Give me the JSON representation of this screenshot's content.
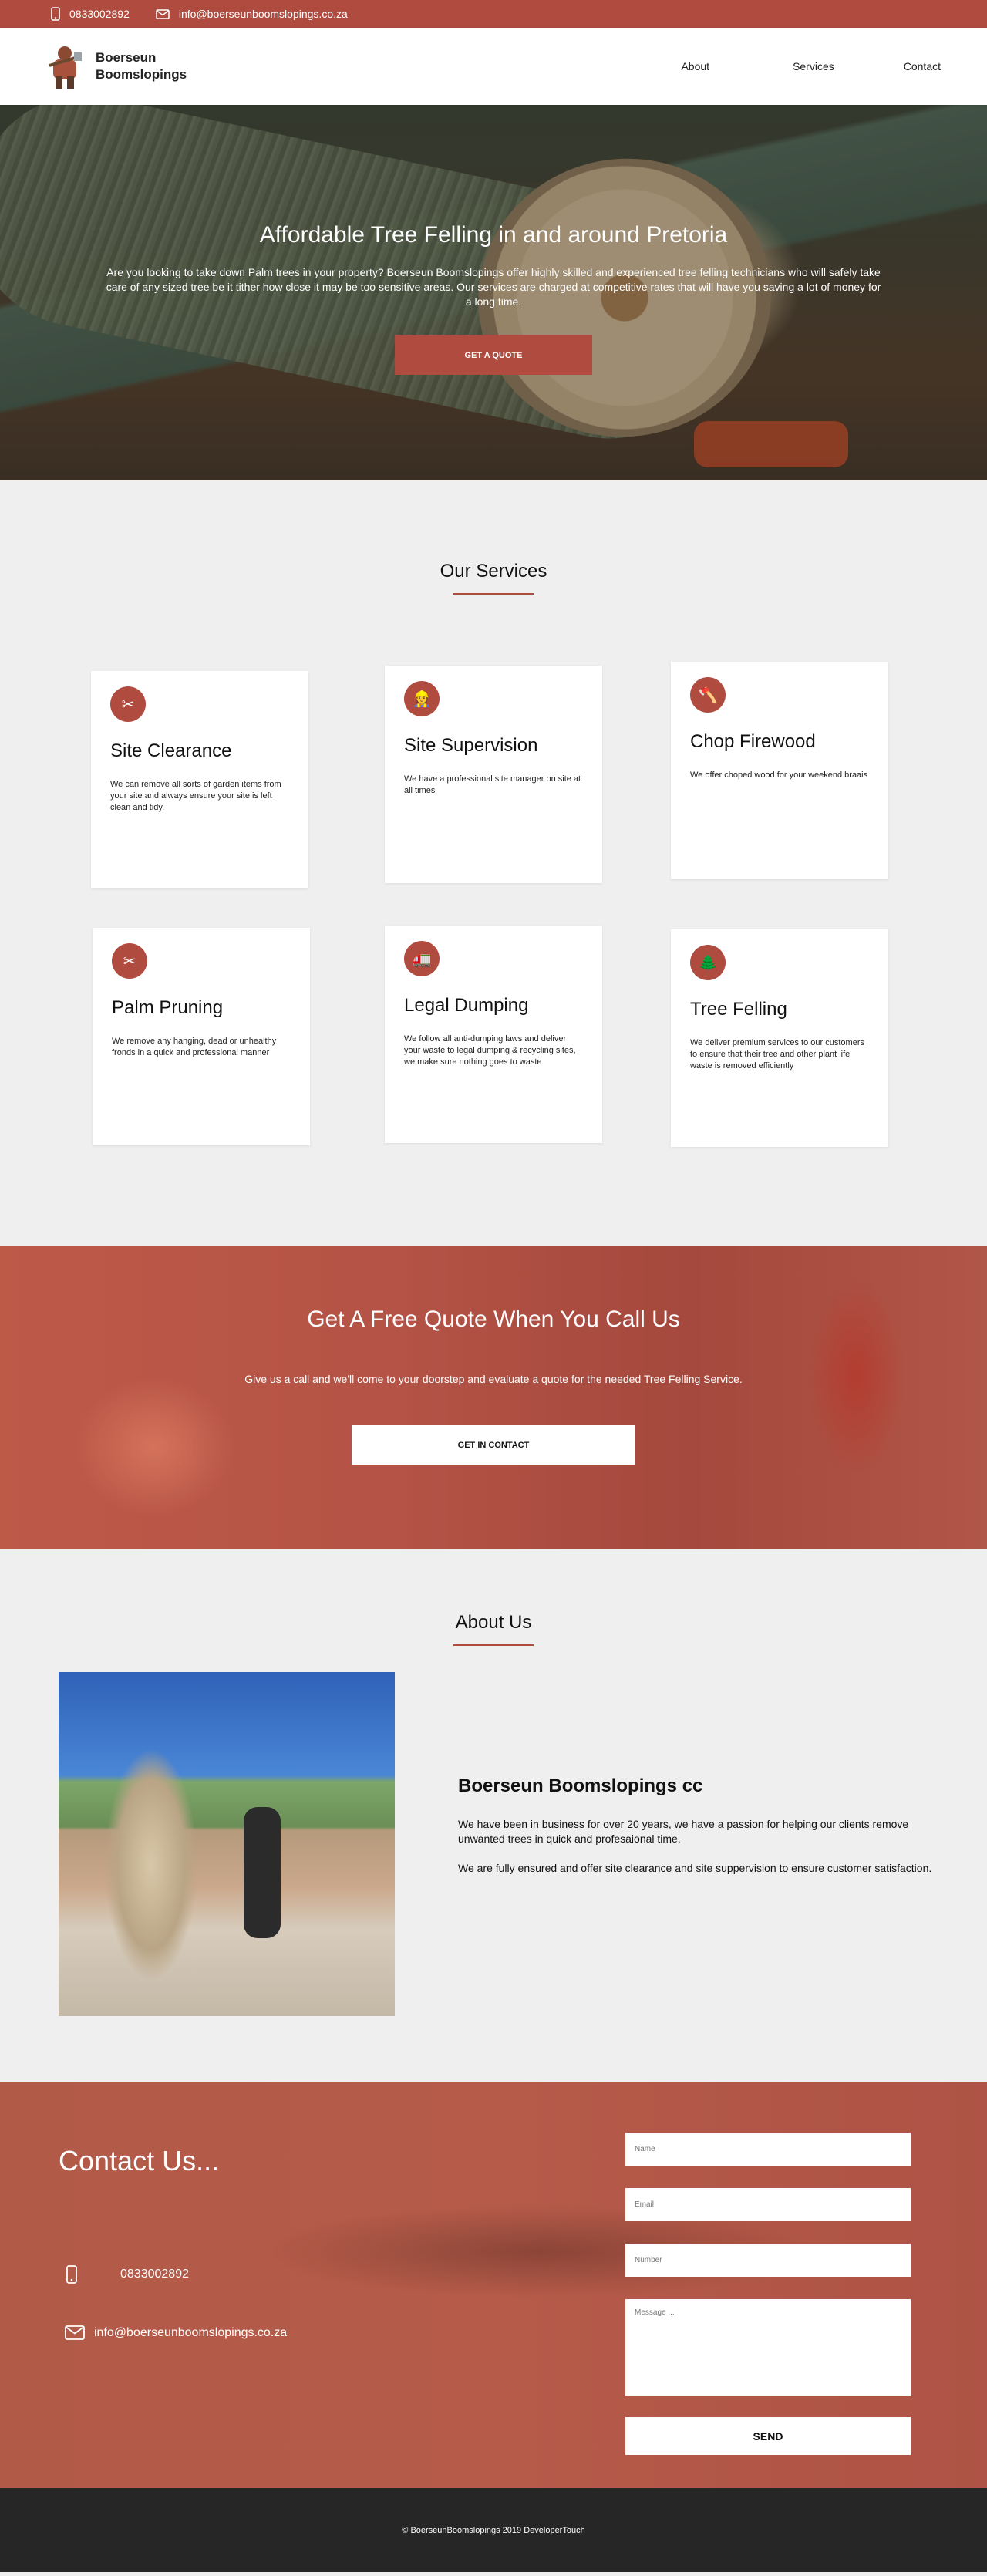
{
  "topbar": {
    "phone": "0833002892",
    "email": "info@boerseunboomslopings.co.za",
    "phone_icon": "phone-icon",
    "email_icon": "mail-icon"
  },
  "header": {
    "brand_line1": "Boerseun",
    "brand_line2": "Boomslopings",
    "nav": [
      "About",
      "Services",
      "Contact"
    ]
  },
  "hero": {
    "title": "Affordable Tree Felling in and around Pretoria",
    "text": "Are you looking to take down Palm trees in your property? Boerseun Boomslopings offer highly skilled and experienced tree felling technicians who will safely take care of any sized tree be it tither how close it may be too sensitive areas. Our services are charged at competitive rates that will have you saving a lot of money for a long time.",
    "button": "GET A QUOTE"
  },
  "services": {
    "title": "Our Services",
    "cards": [
      {
        "title": "Site Clearance",
        "text": "We can remove all sorts of garden items from your site and always ensure your site is left clean and tidy.",
        "icon": "clearance-icon"
      },
      {
        "title": "Site Supervision",
        "text": "We have a professional site manager on site at all times",
        "icon": "supervision-icon"
      },
      {
        "title": "Chop Firewood",
        "text": "We offer choped wood for your weekend braais",
        "icon": "firewood-icon"
      },
      {
        "title": "Palm Pruning",
        "text": "We remove any hanging, dead or unhealthy fronds in a quick and professional manner",
        "icon": "pruning-icon"
      },
      {
        "title": "Legal Dumping",
        "text": "We follow all anti-dumping laws and deliver your waste to legal dumping & recycling sites, we make sure nothing goes to waste",
        "icon": "dumping-icon"
      },
      {
        "title": "Tree Felling",
        "text": "We deliver premium services to our customers to ensure that their tree and other plant life waste is removed efficiently",
        "icon": "felling-icon"
      }
    ]
  },
  "cta": {
    "title": "Get A Free Quote When You Call Us",
    "text": "Give us a call and we'll come to your doorstep and evaluate a quote for the needed Tree Felling Service.",
    "button": "GET IN CONTACT"
  },
  "about": {
    "title": "About Us",
    "heading": "Boerseun Boomslopings cc",
    "p1": "We have been in business for over 20 years, we have a passion for helping our clients remove unwanted trees in quick and profesaional time.",
    "p2": "We are fully ensured and offer site clearance and site suppervision to ensure customer satisfaction."
  },
  "contact": {
    "title": "Contact Us...",
    "phone": "0833002892",
    "email": "info@boerseunboomslopings.co.za",
    "form": {
      "name_placeholder": "Name",
      "email_placeholder": "Email",
      "number_placeholder": "Number",
      "message_placeholder": "Message ...",
      "send": "SEND"
    }
  },
  "footer": {
    "text": "© BoerseunBoomslopings 2019 DeveloperTouch"
  },
  "colors": {
    "accent": "#b04b3f",
    "footer": "#262626"
  }
}
